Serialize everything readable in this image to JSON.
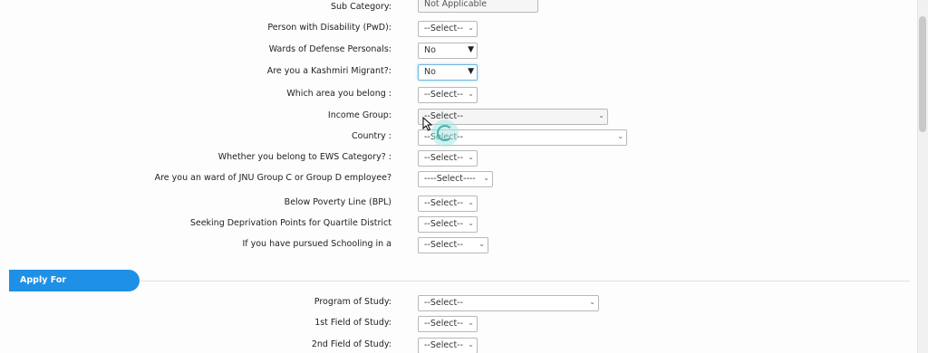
{
  "form": {
    "sub_category": {
      "label": "Sub Category:",
      "value": "Not Applicable"
    },
    "pwd": {
      "label": "Person with Disability (PwD):",
      "value": "--Select--"
    },
    "wards_defense": {
      "label": "Wards of Defense Personals:",
      "value": "No"
    },
    "kashmiri_migrant": {
      "label": "Are you a Kashmiri Migrant?:",
      "value": "No"
    },
    "area": {
      "label": "Which area you belong :",
      "value": "--Select--"
    },
    "income_group": {
      "label": "Income Group:",
      "value": "--Select--"
    },
    "country": {
      "label": "Country :",
      "value": "--Select--"
    },
    "ews": {
      "label": "Whether you belong to EWS Category? :",
      "value": "--Select--"
    },
    "jnu_ward": {
      "label": "Are you an ward of JNU Group C or Group D employee?",
      "value": "----Select----"
    },
    "bpl": {
      "label": "Below Poverty Line (BPL)",
      "value": "--Select--"
    },
    "deprivation": {
      "label": "Seeking Deprivation Points for Quartile District",
      "value": "--Select--"
    },
    "schooling": {
      "label": "If you have pursued Schooling in a",
      "value": "--Select--"
    }
  },
  "apply_for": {
    "title": "Apply For",
    "program": {
      "label": "Program of Study:",
      "value": "--Select--"
    },
    "field1": {
      "label": "1st Field of Study:",
      "value": "--Select--"
    },
    "field2": {
      "label": "2nd Field of Study:",
      "value": "--Select--"
    }
  },
  "icons": {
    "dropdown": "chevron-down-icon",
    "cursor": "mouse-pointer-icon",
    "loader": "loading-spinner-icon"
  },
  "colors": {
    "accent": "#1e90e6",
    "focus": "#6fb7e0",
    "loader": "#39b8b0"
  }
}
